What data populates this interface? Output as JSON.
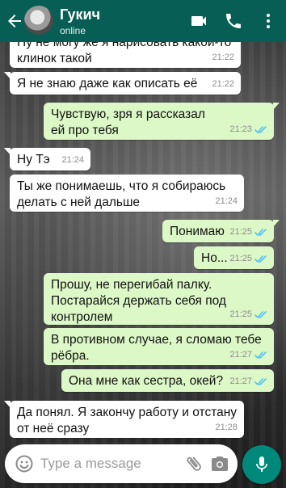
{
  "header": {
    "contact_name": "Гукич",
    "status": "online"
  },
  "icons": {
    "back": "arrow-back-icon",
    "video": "video-call-icon",
    "call": "phone-icon",
    "menu": "more-vert-icon",
    "emoji": "emoji-icon",
    "attach": "paperclip-icon",
    "camera": "camera-icon",
    "mic": "mic-icon"
  },
  "colors": {
    "header": "#075e54",
    "incoming_bubble": "#ffffff",
    "outgoing_bubble": "#dcf8c6",
    "read_ticks": "#4fc3f7",
    "mic_button": "#00897b"
  },
  "messages": [
    {
      "dir": "in",
      "text": "Ну не могу же я нарисовать какой-то клинок такой",
      "time": "21:22"
    },
    {
      "dir": "in",
      "text": "Я не знаю даже как описать её",
      "time": "21:22"
    },
    {
      "dir": "out",
      "text": "Чувствую, зря я рассказал ей про тебя",
      "time": "21:23",
      "read": true
    },
    {
      "dir": "in",
      "text": "Ну Тэ",
      "time": "21:24"
    },
    {
      "dir": "in",
      "text": "Ты же понимаешь, что я собираюсь делать с ней дальше",
      "time": "21:24"
    },
    {
      "dir": "out",
      "text": "Понимаю",
      "time": "21:25",
      "read": true
    },
    {
      "dir": "out",
      "text": "Но...",
      "time": "21:25",
      "read": true
    },
    {
      "dir": "out",
      "text": "Прошу, не перегибай палку. Постарайся держать себя под контролем",
      "time": "21:25",
      "read": true
    },
    {
      "dir": "out",
      "text": "В противном случае, я сломаю тебе рёбра.",
      "time": "21:27",
      "read": true
    },
    {
      "dir": "out",
      "text": "Она мне как сестра, окей?",
      "time": "21:27",
      "read": true
    },
    {
      "dir": "in",
      "text": "Да понял. Я закончу работу и отстану от неё сразу",
      "time": "21:28"
    }
  ],
  "composer": {
    "placeholder": "Type a message"
  }
}
